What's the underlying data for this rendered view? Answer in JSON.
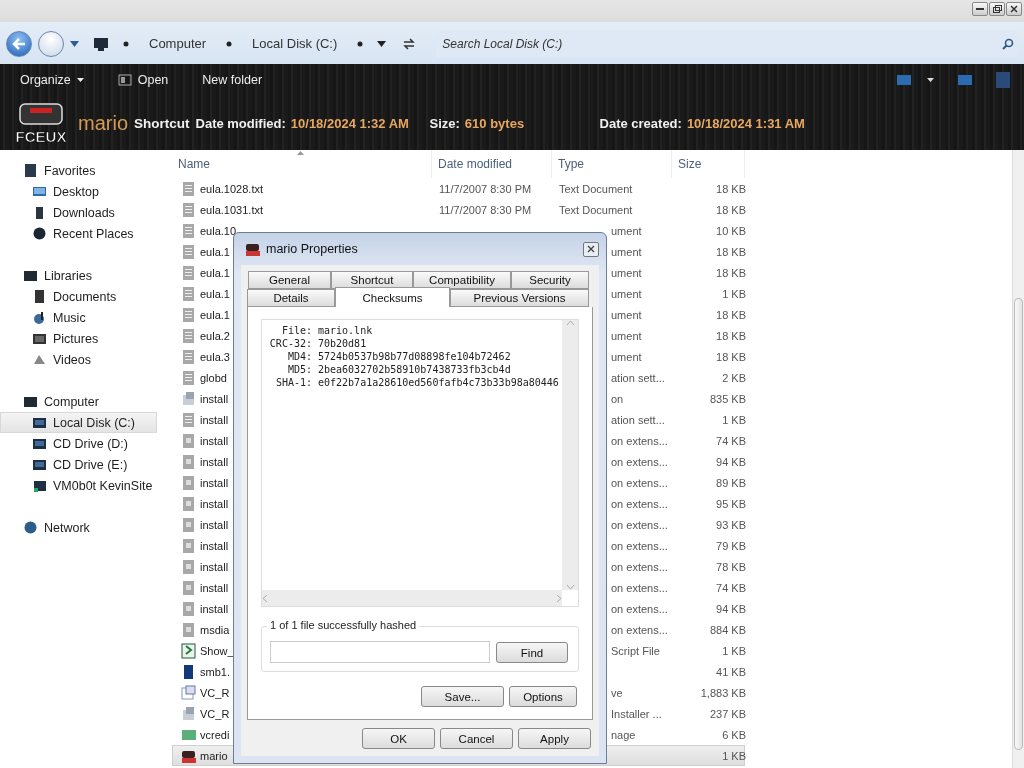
{
  "address_bar": {
    "breadcrumbs": [
      "Computer",
      "Local Disk (C:)"
    ]
  },
  "search": {
    "placeholder": "Search Local Disk (C:)"
  },
  "toolbar": {
    "items": [
      {
        "label": "Organize",
        "kind": "menu"
      },
      {
        "label": "Open",
        "kind": "icon"
      },
      {
        "label": "New folder",
        "kind": "plain"
      }
    ]
  },
  "details": {
    "logo_text": "FCEUX",
    "name": "mario",
    "type": "Shortcut",
    "fields": [
      {
        "label": "Date modified:",
        "value": "10/18/2024 1:32 AM"
      },
      {
        "label": "Size:",
        "value": "610 bytes"
      },
      {
        "label": "Date created:",
        "value": "10/18/2024 1:31 AM"
      }
    ]
  },
  "sidebar": {
    "groups": [
      {
        "label": "Favorites",
        "selected": false,
        "children": [
          {
            "label": "Desktop",
            "selected": false
          },
          {
            "label": "Downloads",
            "selected": false
          },
          {
            "label": "Recent Places",
            "selected": false
          }
        ]
      },
      {
        "label": "Libraries",
        "selected": false,
        "children": [
          {
            "label": "Documents",
            "selected": false
          },
          {
            "label": "Music",
            "selected": false
          },
          {
            "label": "Pictures",
            "selected": false
          },
          {
            "label": "Videos",
            "selected": false
          }
        ]
      },
      {
        "label": "Computer",
        "selected": false,
        "children": [
          {
            "label": "Local Disk (C:)",
            "selected": true
          },
          {
            "label": "CD Drive (D:)",
            "selected": false
          },
          {
            "label": "CD Drive (E:)",
            "selected": false
          },
          {
            "label": "VM0b0t KevinSite",
            "selected": false
          }
        ]
      },
      {
        "label": "Network",
        "selected": false
      }
    ]
  },
  "table": {
    "columns": [
      "Name",
      "Date modified",
      "Type",
      "Size"
    ],
    "rows": [
      {
        "kind": "text",
        "name": "eula.1028.txt",
        "date": "11/7/2007 8:30 PM",
        "type": "Text Document",
        "size": "18 KB",
        "selected": false
      },
      {
        "kind": "text",
        "name": "eula.1031.txt",
        "date": "11/7/2007 8:30 PM",
        "type": "Text Document",
        "size": "18 KB",
        "selected": false
      },
      {
        "kind": "text",
        "name": "eula.10",
        "type": "ument",
        "size": "10 KB",
        "selected": false
      },
      {
        "kind": "text",
        "name": "eula.1",
        "type": "ument",
        "size": "18 KB",
        "selected": false
      },
      {
        "kind": "text",
        "name": "eula.1",
        "type": "ument",
        "size": "18 KB",
        "selected": false
      },
      {
        "kind": "text",
        "name": "eula.1",
        "type": "ument",
        "size": "1 KB",
        "selected": false
      },
      {
        "kind": "text",
        "name": "eula.1",
        "type": "ument",
        "size": "18 KB",
        "selected": false
      },
      {
        "kind": "text",
        "name": "eula.2",
        "type": "ument",
        "size": "18 KB",
        "selected": false
      },
      {
        "kind": "text",
        "name": "eula.3",
        "type": "ument",
        "size": "18 KB",
        "selected": false
      },
      {
        "kind": "text",
        "name": "globd",
        "type": "ation sett...",
        "size": "2 KB",
        "selected": false
      },
      {
        "kind": "setup",
        "name": "install",
        "type": "on",
        "size": "835 KB",
        "selected": false
      },
      {
        "kind": "text",
        "name": "install",
        "type": "ation sett...",
        "size": "1 KB",
        "selected": false
      },
      {
        "kind": "ext",
        "name": "install",
        "type": "on extens...",
        "size": "74 KB",
        "selected": false
      },
      {
        "kind": "ext",
        "name": "install",
        "type": "on extens...",
        "size": "94 KB",
        "selected": false
      },
      {
        "kind": "ext",
        "name": "install",
        "type": "on extens...",
        "size": "89 KB",
        "selected": false
      },
      {
        "kind": "ext",
        "name": "install",
        "type": "on extens...",
        "size": "95 KB",
        "selected": false
      },
      {
        "kind": "ext",
        "name": "install",
        "type": "on extens...",
        "size": "93 KB",
        "selected": false
      },
      {
        "kind": "ext",
        "name": "install",
        "type": "on extens...",
        "size": "79 KB",
        "selected": false
      },
      {
        "kind": "ext",
        "name": "install",
        "type": "on extens...",
        "size": "78 KB",
        "selected": false
      },
      {
        "kind": "ext",
        "name": "install",
        "type": "on extens...",
        "size": "74 KB",
        "selected": false
      },
      {
        "kind": "ext",
        "name": "install",
        "type": "on extens...",
        "size": "94 KB",
        "selected": false
      },
      {
        "kind": "ext",
        "name": "msdia",
        "type": "on extens...",
        "size": "884 KB",
        "selected": false
      },
      {
        "kind": "script",
        "name": "Show_",
        "type": "Script File",
        "size": "1 KB",
        "selected": false
      },
      {
        "kind": "game",
        "name": "smb1.",
        "size": "41 KB",
        "selected": false
      },
      {
        "kind": "cd",
        "name": "VC_R",
        "type": "ve",
        "size": "1,883 KB",
        "selected": false
      },
      {
        "kind": "setup",
        "name": "VC_R",
        "type": "Installer ...",
        "size": "237 KB",
        "selected": false
      },
      {
        "kind": "image",
        "name": "vcredi",
        "type": "nage",
        "size": "6 KB",
        "selected": false
      },
      {
        "kind": "shortcut",
        "name": "mario",
        "size": "1 KB",
        "selected": true
      }
    ]
  },
  "dialog": {
    "title": "mario Properties",
    "tab_rows": [
      [
        {
          "label": "General",
          "selected": false
        },
        {
          "label": "Shortcut",
          "selected": false
        },
        {
          "label": "Compatibility",
          "selected": false
        },
        {
          "label": "Security",
          "selected": false
        }
      ],
      [
        {
          "label": "Details",
          "selected": false
        },
        {
          "label": "Checksums",
          "selected": true
        },
        {
          "label": "Previous Versions",
          "selected": false
        }
      ]
    ],
    "hashes": [
      {
        "label": "File:",
        "value": "mario.lnk"
      },
      {
        "label": "CRC-32:",
        "value": "70b20d81"
      },
      {
        "label": "MD4:",
        "value": "5724b0537b98b77d08898fe104b72462"
      },
      {
        "label": "MD5:",
        "value": "2bea6032702b58910b7438733fb3cb4d"
      },
      {
        "label": "SHA-1:",
        "value": "e0f22b7a1a28610ed560fafb4c73b33b98a80446"
      }
    ],
    "status": "1 of 1 file successfully hashed",
    "find_button": "Find",
    "action_buttons": [
      "Save...",
      "Options"
    ],
    "footer_buttons": [
      "OK",
      "Cancel",
      "Apply"
    ]
  }
}
